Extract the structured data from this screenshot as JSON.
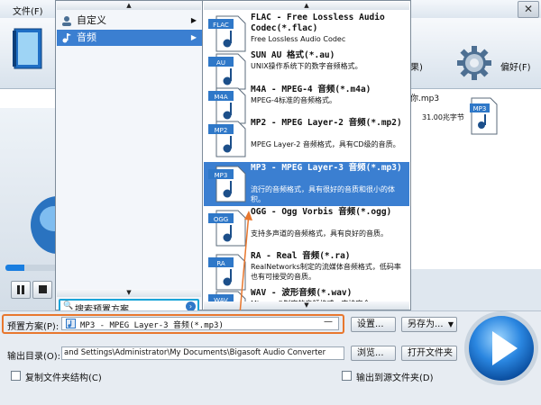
{
  "menubar": {
    "file_label": "文件(F)",
    "close_glyph": "✕"
  },
  "toolbar": {
    "result_label": "果)",
    "preferences_label": "偏好(F)"
  },
  "filelist": {
    "file_name": "你.mp3",
    "file_size": "31.00兆字节",
    "file_icon": "MP3"
  },
  "category_menu": {
    "items": [
      {
        "label": "自定义",
        "icon": "user-icon",
        "arrow": "▶"
      },
      {
        "label": "音频",
        "icon": "music-icon",
        "arrow": "▶"
      }
    ],
    "search_placeholder": "搜索预置方案..."
  },
  "format_menu": {
    "items": [
      {
        "badge": "FLAC",
        "title": "FLAC - Free Lossless Audio Codec(*.flac)",
        "desc": "Free Lossless Audio Codec"
      },
      {
        "badge": "AU",
        "title": "SUN AU 格式(*.au)",
        "desc": "UNIX操作系统下的数字音频格式。"
      },
      {
        "badge": "M4A",
        "title": "M4A - MPEG-4 音频(*.m4a)",
        "desc": "MPEG-4标准的音频格式。"
      },
      {
        "badge": "MP2",
        "title": "MP2 - MPEG Layer-2 音频(*.mp2)",
        "desc": "MPEG Layer-2 音频格式，具有CD级的音质。"
      },
      {
        "badge": "MP3",
        "title": "MP3 - MPEG Layer-3 音频(*.mp3)",
        "desc": "流行的音频格式，具有很好的音质和很小的体积。"
      },
      {
        "badge": "OGG",
        "title": "OGG - Ogg Vorbis 音频(*.ogg)",
        "desc": "支持多声道的音频格式，具有良好的音质。"
      },
      {
        "badge": "RA",
        "title": "RA - Real 音频(*.ra)",
        "desc": "RealNetworks制定的流媒体音频格式，低码率也有可接受的音质。"
      },
      {
        "badge": "WAV",
        "title": "WAV - 波形音频(*.wav)",
        "desc": "Microsoft制定的音频格式，支持完全"
      }
    ]
  },
  "bottom": {
    "preset_label": "预置方案(P):",
    "preset_value": "MP3 - MPEG Layer-3 音频(*.mp3)",
    "preset_dash": "—",
    "settings_button": "设置...",
    "save_as_button": "另存为...",
    "output_label": "输出目录(O):",
    "output_value": "and Settings\\Administrator\\My Documents\\Bigasoft Audio Converter",
    "browse_button": "浏览...",
    "open_folder_button": "打开文件夹",
    "copy_structure_label": "复制文件夹结构(C)",
    "output_to_source_label": "输出到源文件夹(D)"
  },
  "colors": {
    "accent": "#3b7fd1",
    "highlight_orange": "#e8772e",
    "search_border": "#1aa4d8"
  }
}
